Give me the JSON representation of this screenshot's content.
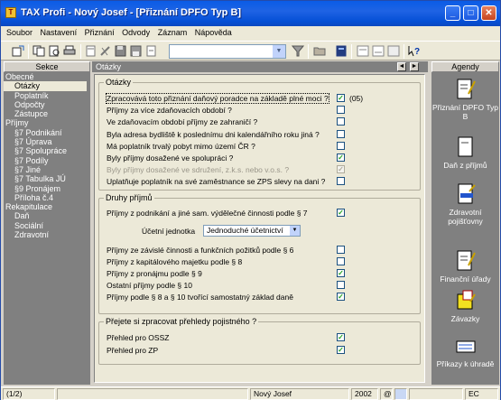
{
  "window": {
    "title": "TAX Profi - Nový Josef - [Přiznání DPFO Typ B]",
    "app_icon_text": "T"
  },
  "menu": [
    "Soubor",
    "Nastavení",
    "Přiznání",
    "Odvody",
    "Záznam",
    "Nápověda"
  ],
  "left_panel": {
    "header": "Sekce",
    "items": [
      {
        "label": "Obecné",
        "level": 1,
        "selected": false
      },
      {
        "label": "Otázky",
        "level": 2,
        "selected": true
      },
      {
        "label": "Poplatník",
        "level": 2,
        "selected": false
      },
      {
        "label": "Odpočty",
        "level": 2,
        "selected": false
      },
      {
        "label": "Zástupce",
        "level": 2,
        "selected": false
      },
      {
        "label": "Příjmy",
        "level": 1,
        "selected": false
      },
      {
        "label": "§7 Podnikání",
        "level": 2,
        "selected": false
      },
      {
        "label": "§7 Úprava",
        "level": 2,
        "selected": false
      },
      {
        "label": "§7 Spolupráce",
        "level": 2,
        "selected": false
      },
      {
        "label": "§7 Podíly",
        "level": 2,
        "selected": false
      },
      {
        "label": "§7 Jiné",
        "level": 2,
        "selected": false
      },
      {
        "label": "§7 Tabulka JÚ",
        "level": 2,
        "selected": false
      },
      {
        "label": "§9 Pronájem",
        "level": 2,
        "selected": false
      },
      {
        "label": "Příloha č.4",
        "level": 2,
        "selected": false
      },
      {
        "label": "Rekapitulace",
        "level": 1,
        "selected": false
      },
      {
        "label": "Daň",
        "level": 2,
        "selected": false
      },
      {
        "label": "Sociální",
        "level": 2,
        "selected": false
      },
      {
        "label": "Zdravotní",
        "level": 2,
        "selected": false
      }
    ]
  },
  "center": {
    "header": "Otázky",
    "prev_label": "◄",
    "next_label": "►",
    "group1": {
      "title": "Otázky",
      "rows": [
        {
          "label": "Zpracovává toto přiznání daňový poradce na základě plné moci ?",
          "checked": true,
          "disabled": false,
          "extra": "(05)"
        },
        {
          "label": "Příjmy za více zdaňovacích období ?",
          "checked": false,
          "disabled": false,
          "extra": ""
        },
        {
          "label": "Ve zdaňovacím období příjmy ze zahraničí ?",
          "checked": false,
          "disabled": false,
          "extra": ""
        },
        {
          "label": "Byla adresa bydliště k poslednímu dni kalendářního roku jiná ?",
          "checked": false,
          "disabled": false,
          "extra": ""
        },
        {
          "label": "Má poplatník trvalý pobyt mimo území ČR ?",
          "checked": false,
          "disabled": false,
          "extra": ""
        },
        {
          "label": "Byly příjmy dosažené ve spolupráci ?",
          "checked": true,
          "disabled": false,
          "extra": ""
        },
        {
          "label": "Byly příjmy dosažené ve sdružení, z.k.s. nebo v.o.s. ?",
          "checked": true,
          "disabled": true,
          "extra": ""
        },
        {
          "label": "Uplatňuje poplatník na své zaměstnance se ZPS slevy na dani ?",
          "checked": false,
          "disabled": false,
          "extra": ""
        }
      ]
    },
    "group2": {
      "title": "Druhy příjmů",
      "row_business": {
        "label": "Příjmy z podnikání a jiné sam. výdělečné činnosti podle § 7",
        "checked": true
      },
      "accounting_label": "Účetní jednotka",
      "accounting_value": "Jednoduché účetnictví",
      "rows": [
        {
          "label": "Příjmy ze závislé činnosti a funkčních požitků podle § 6",
          "checked": false
        },
        {
          "label": "Příjmy z kapitálového majetku podle § 8",
          "checked": false
        },
        {
          "label": "Příjmy z pronájmu podle § 9",
          "checked": true
        },
        {
          "label": "Ostatní příjmy podle § 10",
          "checked": false
        },
        {
          "label": "Příjmy podle § 8 a § 10 tvořící samostatný základ daně",
          "checked": true
        }
      ]
    },
    "group3": {
      "title": "Přejete si zpracovat přehledy pojistného ?",
      "rows": [
        {
          "label": "Přehled pro OSSZ",
          "checked": true
        },
        {
          "label": "Přehled pro ZP",
          "checked": true
        }
      ]
    }
  },
  "right_panel": {
    "header": "Agendy",
    "items": [
      {
        "label": "Přiznání DPFO Typ B",
        "icon": "document-pen-icon"
      },
      {
        "label": "Daň z příjmů",
        "icon": "document-icon"
      },
      {
        "label": "Zdravotní pojišťovny",
        "icon": "document-stamp-icon"
      },
      {
        "label": "Finanční úřady",
        "icon": "document-pen-icon"
      },
      {
        "label": "Závazky",
        "icon": "folder-note-icon"
      },
      {
        "label": "Příkazy k úhradě",
        "icon": "payment-order-icon"
      }
    ]
  },
  "status": {
    "page": "(1/2)",
    "user": "Nový Josef",
    "year": "2002",
    "at": "@",
    "lang": "EC"
  },
  "colors": {
    "title_blue": "#0a5ce6",
    "panel_gray": "#808080",
    "check_green": "#21a121"
  }
}
